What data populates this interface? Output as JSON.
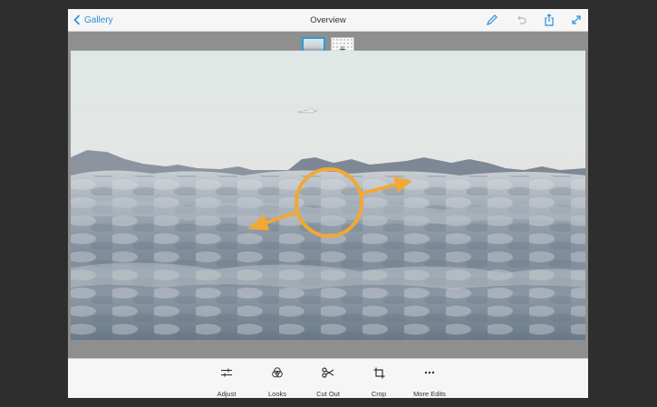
{
  "header": {
    "back_label": "Gallery",
    "title": "Overview",
    "icons": [
      "pencil-icon",
      "undo-icon",
      "share-icon",
      "expand-icon"
    ]
  },
  "thumbnails": {
    "selected": "photo-thumbnail",
    "add_symbol": "+"
  },
  "overlay": {
    "gesture": "drag-handle-with-two-arrows",
    "color": "#f2a833"
  },
  "toolbar": {
    "items": [
      {
        "label": "Adjust",
        "icon": "sliders-icon"
      },
      {
        "label": "Looks",
        "icon": "looks-icon"
      },
      {
        "label": "Cut Out",
        "icon": "scissors-icon"
      },
      {
        "label": "Crop",
        "icon": "crop-icon"
      },
      {
        "label": "More Edits",
        "icon": "more-icon"
      }
    ]
  },
  "colors": {
    "accent": "#2a8ed8",
    "frame": "#2e2e2e",
    "bar": "#f6f6f6"
  }
}
